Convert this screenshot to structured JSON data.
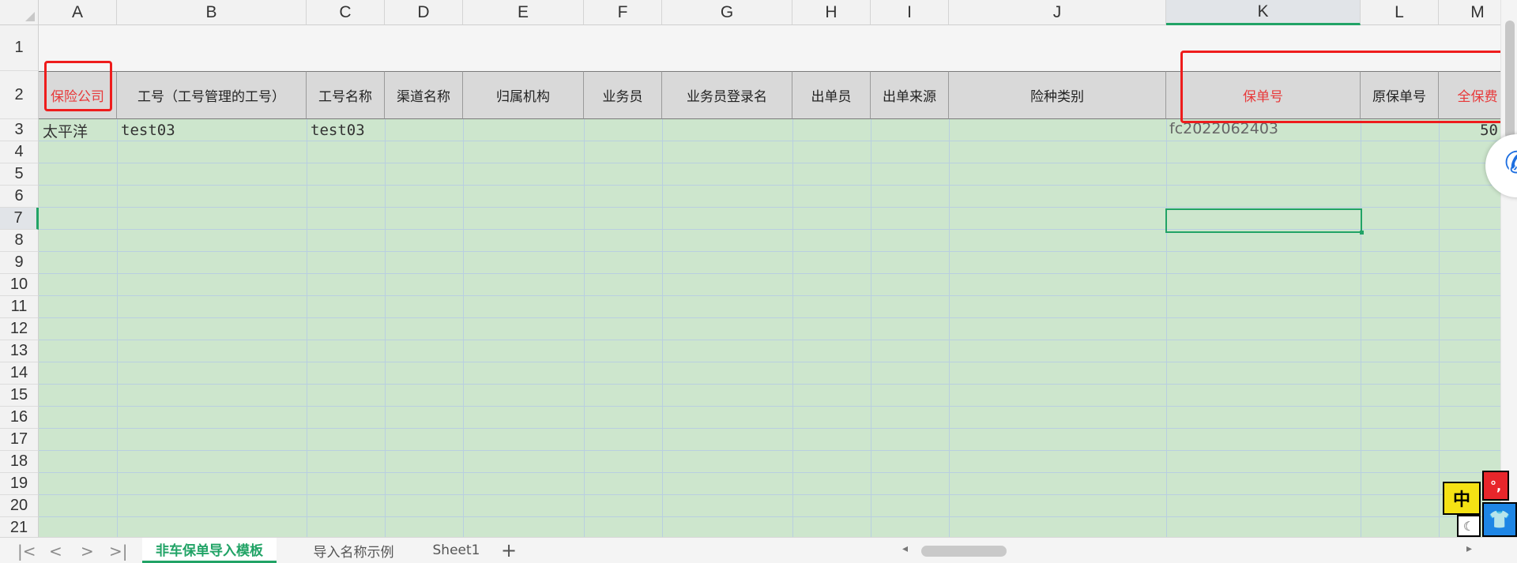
{
  "columns": [
    "A",
    "B",
    "C",
    "D",
    "E",
    "F",
    "G",
    "H",
    "I",
    "J",
    "K",
    "L",
    "M"
  ],
  "rows": [
    "1",
    "2",
    "3",
    "4",
    "5",
    "6",
    "7",
    "8",
    "9",
    "10",
    "11",
    "12",
    "13",
    "14",
    "15",
    "16",
    "17",
    "18",
    "19",
    "20",
    "21"
  ],
  "headers": [
    "保险公司",
    "工号（工号管理的工号）",
    "工号名称",
    "渠道名称",
    "归属机构",
    "业务员",
    "业务员登录名",
    "出单员",
    "出单来源",
    "险种类别",
    "保单号",
    "原保单号",
    "全保费"
  ],
  "red_headers": [
    "A",
    "K",
    "M"
  ],
  "row3": {
    "A": "太平洋",
    "B": "test03",
    "C": "test03",
    "K": "fc2022062403",
    "M": "50"
  },
  "selected_cell": "K7",
  "tabs": [
    "非车保单导入模板",
    "导入名称示例",
    "Sheet1"
  ],
  "active_tab": "非车保单导入模板",
  "ime": {
    "main": "中",
    "punct": "°,"
  },
  "colors": {
    "header_bg": "#d9d9d9",
    "data_bg": "#cde6cd",
    "accent": "#21a366",
    "annotation": "#ee1c1c",
    "red_text": "#e8393a"
  }
}
